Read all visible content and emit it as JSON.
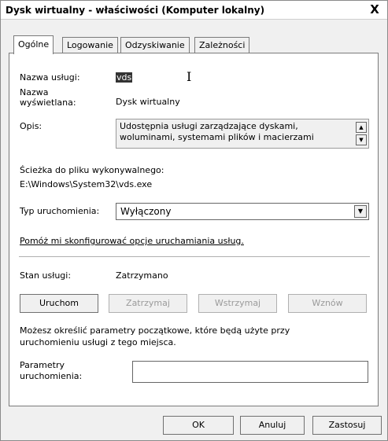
{
  "window": {
    "title": "Dysk wirtualny - właściwości (Komputer lokalny)",
    "close_label": "X"
  },
  "tabs": [
    {
      "label": "Ogólne",
      "active": true
    },
    {
      "label": "Logowanie",
      "active": false
    },
    {
      "label": "Odzyskiwanie",
      "active": false
    },
    {
      "label": "Zależności",
      "active": false
    }
  ],
  "general": {
    "service_name_label": "Nazwa usługi:",
    "service_name_value": "vds",
    "display_name_label_line1": "Nazwa",
    "display_name_label_line2": "wyświetlana:",
    "display_name_value": "Dysk wirtualny",
    "description_label": "Opis:",
    "description_line1": "Udostępnia usługi zarządzające dyskami,",
    "description_line2": "woluminami, systemami plików i macierzami",
    "path_label": "Ścieżka do pliku wykonywalnego:",
    "path_value": "E:\\Windows\\System32\\vds.exe",
    "startup_type_label": "Typ uruchomienia:",
    "startup_type_value": "Wyłączony",
    "help_link": "Pomóż mi skonfigurować opcje uruchamiania usług.",
    "status_label": "Stan usługi:",
    "status_value": "Zatrzymano",
    "start_button": "Uruchom",
    "stop_button": "Zatrzymaj",
    "pause_button": "Wstrzymaj",
    "resume_button": "Wznów",
    "params_info_line1": "Możesz określić parametry początkowe, które będą użyte przy",
    "params_info_line2": "uruchomieniu usługi z tego miejsca.",
    "params_label_line1": "Parametry",
    "params_label_line2": "uruchomienia:",
    "params_value": ""
  },
  "buttons": {
    "ok": "OK",
    "cancel": "Anuluj",
    "apply": "Zastosuj"
  }
}
